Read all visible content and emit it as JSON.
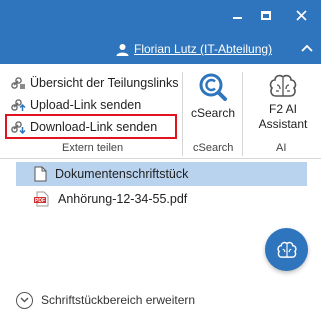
{
  "user": {
    "name": "Florian Lutz (IT-Abteilung)"
  },
  "ribbon": {
    "extern_items": [
      {
        "label": "Übersicht der Teilungslinks",
        "icon": "link-overview-icon"
      },
      {
        "label": "Upload-Link senden",
        "icon": "upload-link-icon"
      },
      {
        "label": "Download-Link senden",
        "icon": "download-link-icon"
      }
    ],
    "group_extern": "Extern teilen",
    "csearch": {
      "label": "cSearch",
      "group": "cSearch"
    },
    "ai": {
      "label_line1": "F2 AI",
      "label_line2": "Assistant",
      "group": "AI"
    }
  },
  "files": [
    {
      "name": "Dokumentenschriftstück",
      "icon": "document-icon",
      "selected": true
    },
    {
      "name": "Anhörung-12-34-55.pdf",
      "icon": "pdf-icon",
      "badge": "PDF"
    }
  ],
  "expand": {
    "label": "Schriftstückbereich erweitern"
  },
  "colors": {
    "titlebar": "#2f75bd",
    "selection": "#b9d3ee",
    "highlight": "#e0141e"
  }
}
